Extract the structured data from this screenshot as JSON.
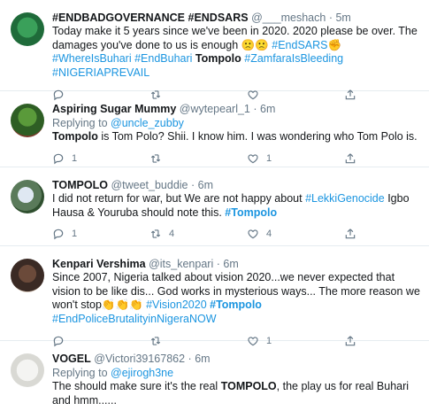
{
  "tweets": [
    {
      "name": "#ENDBADGOVERNANCE #ENDSARS",
      "handle": "@___meshach",
      "time": "5m",
      "segments": [
        {
          "t": "Today make it 5 years since we've been in 2020. 2020 please be over. The damages you've done to us is enough ",
          "s": "text"
        },
        {
          "t": "🙁🙁 ",
          "s": "text"
        },
        {
          "t": "#EndSARS",
          "s": "tag"
        },
        {
          "t": "✊ ",
          "s": "text"
        },
        {
          "t": "#WhereIsBuhari",
          "s": "tag"
        },
        {
          "t": " ",
          "s": "text"
        },
        {
          "t": "#EndBuhari",
          "s": "tag"
        },
        {
          "t": " ",
          "s": "text"
        },
        {
          "t": "Tompolo",
          "s": "bold"
        },
        {
          "t": " ",
          "s": "text"
        },
        {
          "t": "#ZamfaraIsBleeding",
          "s": "tag"
        },
        {
          "t": " ",
          "s": "text"
        },
        {
          "t": "#NIGERIAPREVAIL",
          "s": "tag"
        }
      ],
      "counts": {
        "reply": "",
        "retweet": "",
        "like": ""
      }
    },
    {
      "name": "Aspiring Sugar Mummy",
      "handle": "@wytepearl_1",
      "time": "6m",
      "reply_prefix": "Replying to ",
      "reply_to": "@uncle_zubby",
      "segments": [
        {
          "t": "Tompolo",
          "s": "bold"
        },
        {
          "t": " is Tom Polo? Shii. I know him. I was wondering who Tom Polo is.",
          "s": "text"
        }
      ],
      "counts": {
        "reply": "1",
        "retweet": "",
        "like": "1"
      }
    },
    {
      "name": "TOMPOLO",
      "handle": "@tweet_buddie",
      "time": "6m",
      "segments": [
        {
          "t": "I did not return for war, but We are not happy about ",
          "s": "text"
        },
        {
          "t": "#LekkiGenocide",
          "s": "tag"
        },
        {
          "t": " Igbo Hausa & Youruba should note this. ",
          "s": "text"
        },
        {
          "t": "#Tompolo",
          "s": "tagbold"
        }
      ],
      "counts": {
        "reply": "1",
        "retweet": "4",
        "like": "4"
      }
    },
    {
      "name": "Kenpari Vershima",
      "handle": "@its_kenpari",
      "time": "6m",
      "segments": [
        {
          "t": "Since 2007, Nigeria talked about vision 2020...we never expected that vision to be like dis... God works in mysterious ways... The more reason we won't stop",
          "s": "text"
        },
        {
          "t": "👏👏👏 ",
          "s": "text"
        },
        {
          "t": "#Vision2020",
          "s": "tag"
        },
        {
          "t": " ",
          "s": "text"
        },
        {
          "t": "#Tompolo",
          "s": "tagbold"
        },
        {
          "t": " ",
          "s": "text"
        },
        {
          "t": "#EndPoliceBrutalityinNigeraNOW",
          "s": "tag"
        }
      ],
      "counts": {
        "reply": "",
        "retweet": "",
        "like": "1"
      }
    },
    {
      "name": "VOGEL",
      "handle": "@Victori39167862",
      "time": "6m",
      "reply_prefix": "Replying to ",
      "reply_to": "@ejirogh3ne",
      "segments": [
        {
          "t": "The should make sure it's the real ",
          "s": "text"
        },
        {
          "t": "TOMPOLO",
          "s": "bold"
        },
        {
          "t": ", the play us for real Buhari and hmm......",
          "s": "text"
        }
      ],
      "counts": {
        "reply": "",
        "retweet": "",
        "like": ""
      }
    }
  ],
  "colors": {
    "link": "#1b95e0",
    "meta": "#657786",
    "text": "#14171a",
    "divider": "#e6ecf0"
  },
  "icons": [
    "reply-icon",
    "retweet-icon",
    "like-icon",
    "share-icon"
  ]
}
